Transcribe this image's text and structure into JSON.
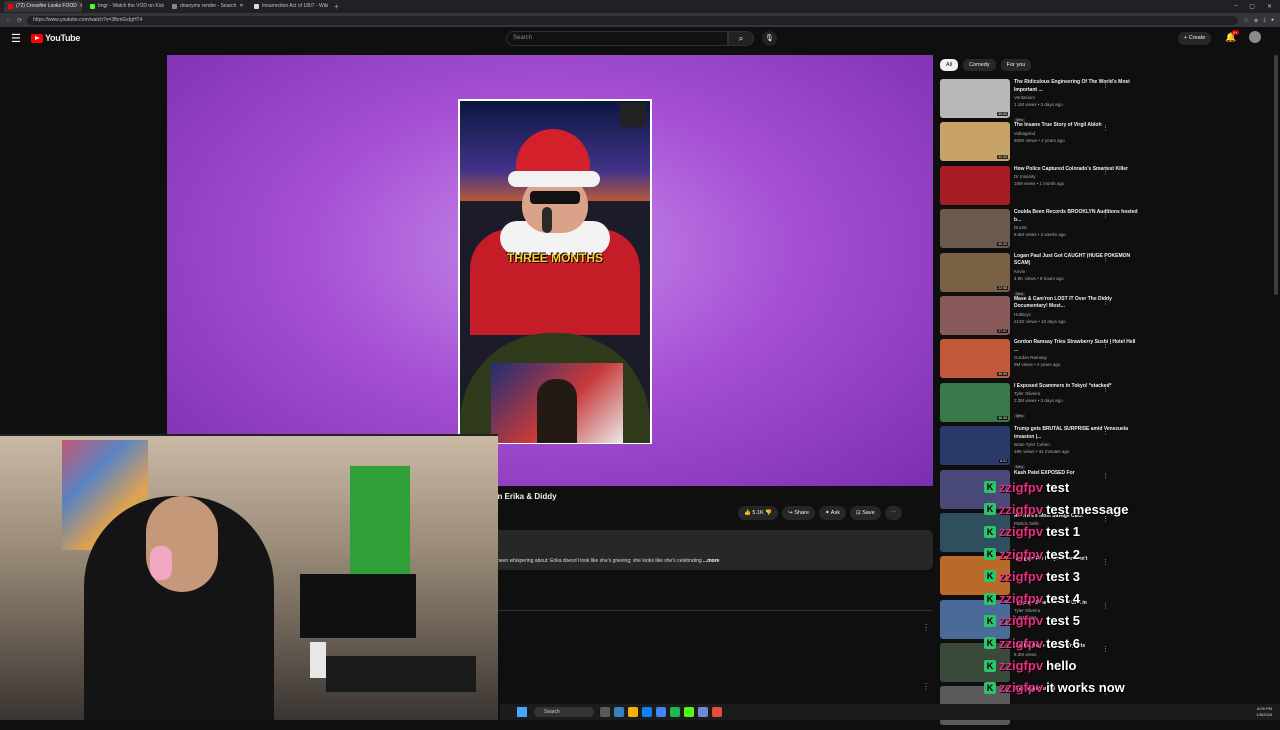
{
  "browser": {
    "tabs": [
      {
        "label": "(72) Crossfire Looks FOOD",
        "active": true
      },
      {
        "label": "Imgr - Watch the VOD on Kick",
        "active": false
      },
      {
        "label": "dnanyms render - Search",
        "active": false
      },
      {
        "label": "Insurrection Act of 1807 - Wikipe",
        "active": false
      }
    ],
    "url": "https://www.youtube.com/watch?v=3fbmGsIgHT4"
  },
  "header": {
    "logo_text": "YouTube",
    "search_placeholder": "Search",
    "create_label": "Create",
    "notification_count": "9+"
  },
  "video": {
    "caption_text": "THREE MONTHS",
    "title_partial": "an Erika & Diddy",
    "likes": "5.1K",
    "share_label": "Share",
    "ask_label": "Ask",
    "save_label": "Save",
    "description": "been whispering about: Erika doesn't look like she's grieving; she looks like she's celebrating",
    "more_label": "...more"
  },
  "sidebar": {
    "chips": [
      "All",
      "Comedy",
      "For you"
    ],
    "items": [
      {
        "title": "The Ridiculous Engineering Of The World's Most Important ...",
        "channel": "Veritasium",
        "views": "1.1M views • 3 days ago",
        "badge": "New",
        "duration": "30:00",
        "color": "#b8b8b8"
      },
      {
        "title": "The Insane True Story of Virgil Abloh",
        "channel": "Volkagrind",
        "views": "600K views • 2 years ago",
        "badge": "",
        "duration": "32:20",
        "color": "#c7a36a"
      },
      {
        "title": "How Police Captured Colorado's Smartest Killer",
        "channel": "Dr Insanity",
        "views": "16M views • 1 month ago",
        "badge": "",
        "duration": "",
        "color": "#a51c24"
      },
      {
        "title": "Coulda Been Records BROOKLYN Auditions hosted b...",
        "channel": "Druski",
        "views": "8.6M views • 2 weeks ago",
        "badge": "",
        "duration": "40:20",
        "color": "#6b5a4e"
      },
      {
        "title": "Logan Paul Just Got CAUGHT (HUGE POKEMON SCAM)",
        "channel": "Kevin",
        "views": "4.9K views • 8 hours ago",
        "badge": "New",
        "duration": "22:58",
        "color": "#7a6145"
      },
      {
        "title": "Mase & Cam'ron LOST IT Over The Diddy Documentary! Most...",
        "channel": "HotBoyz",
        "views": "212K views • 10 days ago",
        "badge": "",
        "duration": "27:37",
        "color": "#8a5a5a"
      },
      {
        "title": "Gordon Ramsay Tries Strawberry Sushi | Hotel Hell ...",
        "channel": "Gordon Ramsay",
        "views": "5M views • 4 years ago",
        "badge": "",
        "duration": "39:39",
        "color": "#c25a3a"
      },
      {
        "title": "I Exposed Scammers in Tokyo! *stacked*",
        "channel": "Tyler Oliveira",
        "views": "2.3M views • 3 days ago",
        "badge": "New",
        "duration": "46:36",
        "color": "#3a7a4a"
      },
      {
        "title": "Trump gets BRUTAL SURPRISE amid Venezuela invasion |...",
        "channel": "Brian Tyler Cohen",
        "views": "19K views • 44 minutes ago",
        "badge": "New",
        "duration": "8:21",
        "color": "#2a3a6a"
      },
      {
        "title": "Kash Patel EXPOSED For",
        "channel": "",
        "views": "",
        "badge": "",
        "duration": "",
        "color": "#4a4a7a"
      },
      {
        "title": "America's Most Savage CEO:",
        "channel": "Patrick Sells",
        "views": "",
        "badge": "",
        "duration": "",
        "color": "#2f4f5f"
      },
      {
        "title": "Gadgets For People Who Don't",
        "channel": "",
        "views": "",
        "badge": "",
        "duration": "",
        "color": "#b86a2a"
      },
      {
        "title": "I Exposed the Most Evil Cult in",
        "channel": "Tyler Oliveira",
        "views": "4.3M views",
        "badge": "",
        "duration": "",
        "color": "#4a6a9a"
      },
      {
        "title": "Coulda Been Security Tryouts",
        "channel": "",
        "views": "8.3M views",
        "badge": "",
        "duration": "",
        "color": "#3a4a3a"
      },
      {
        "title": "This is just brutal",
        "channel": "",
        "views": "",
        "badge": "",
        "duration": "",
        "color": "#5a5a5a"
      }
    ]
  },
  "chat": {
    "messages": [
      {
        "user": "zzigfpv",
        "text": "test"
      },
      {
        "user": "zzigfpv",
        "text": "test message"
      },
      {
        "user": "zzigfpv",
        "text": "test 1"
      },
      {
        "user": "zzigfpv",
        "text": "test 2"
      },
      {
        "user": "zzigfpv",
        "text": "test 3"
      },
      {
        "user": "zzigfpv",
        "text": "test 4"
      },
      {
        "user": "zzigfpv",
        "text": "test 5"
      },
      {
        "user": "zzigfpv",
        "text": "test 6"
      },
      {
        "user": "zzigfpv",
        "text": "hello"
      },
      {
        "user": "zzigfpv",
        "text": "it works now"
      }
    ]
  },
  "taskbar": {
    "search_label": "Search",
    "time": "8:09 PM",
    "date": "1/5/2026"
  },
  "colors": {
    "accent": "#ff0000",
    "kick_green": "#2ec26b",
    "chat_user": "#e82d7f"
  }
}
